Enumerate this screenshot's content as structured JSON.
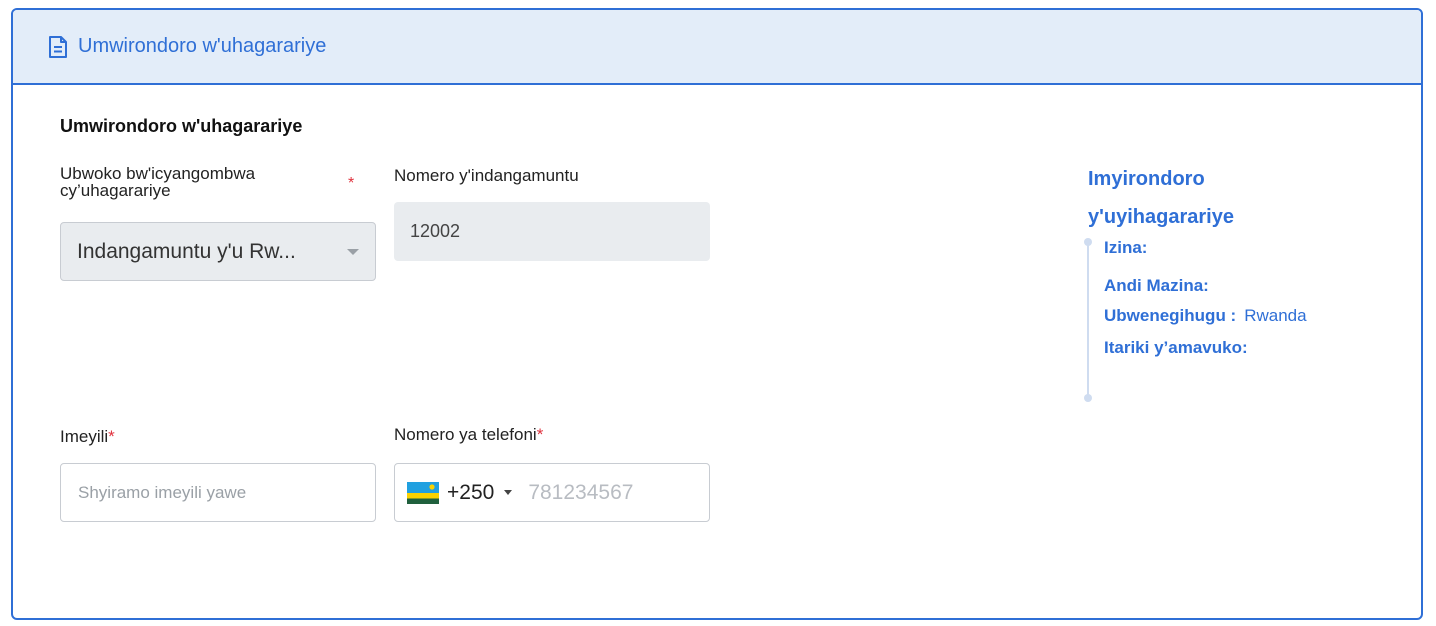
{
  "header": {
    "title": "Umwirondoro w'uhagarariye",
    "icon": "document-icon"
  },
  "section": {
    "title": "Umwirondoro w'uhagarariye"
  },
  "form": {
    "document_type": {
      "label_line1": "Ubwoko bw'icyangombwa",
      "label_line2": "cy’uhagarariye",
      "required_mark": "*",
      "value": "Indangamuntu y'u Rw..."
    },
    "id_number": {
      "label": "Nomero y'indangamuntu",
      "value": "12002"
    },
    "email": {
      "label": "Imeyili",
      "required_mark": "*",
      "placeholder": "Shyiramo imeyili yawe"
    },
    "phone": {
      "label": "Nomero ya telefoni",
      "required_mark": "*",
      "country_code": "+250",
      "placeholder": "781234567",
      "flag_icon": "rwanda-flag-icon"
    }
  },
  "side_panel": {
    "title": "Imyirondoro y'uyihagarariye",
    "rows": [
      {
        "key": "Izina:",
        "value": ""
      },
      {
        "key": "Andi Mazina:",
        "value": ""
      },
      {
        "key": "Ubwenegihugu :",
        "value": "Rwanda"
      },
      {
        "key": "Itariki y’amavuko:",
        "value": ""
      }
    ]
  },
  "colors": {
    "accent": "#2f6fd6",
    "header_bg": "#e3edf9",
    "required": "#e0313d",
    "disabled_bg": "#e9ecef"
  }
}
